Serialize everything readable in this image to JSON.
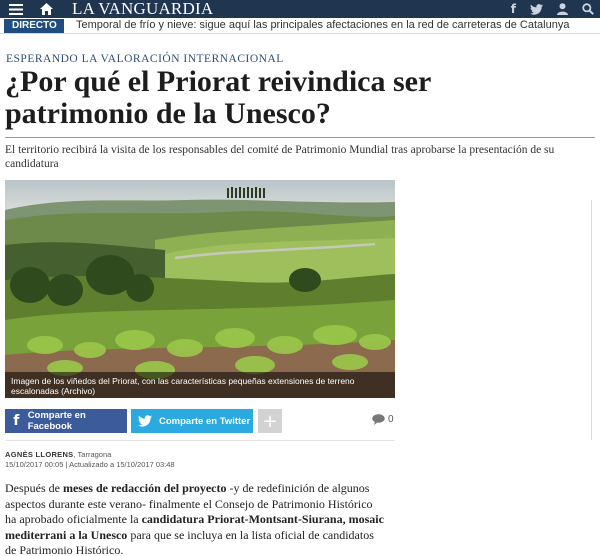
{
  "header": {
    "logo": "LA VANGUARDIA",
    "social": [
      "f",
      "t",
      "user",
      "search"
    ]
  },
  "breaking": {
    "tag": "DIRECTO",
    "headline": "Temporal de frío y nieve: sigue aquí las principales afectaciones en la red de carreteras de Catalunya"
  },
  "article": {
    "kicker": "ESPERANDO LA VALORACIÓN INTERNACIONAL",
    "title": "¿Por qué el Priorat reivindica ser patrimonio de la Unesco?",
    "subtitle": "El territorio recibirá la visita de los responsables del comité de Patrimonio Mundial tras aprobarse la presentación de su candidatura",
    "image_caption": "Imagen de los viñedos del Priorat, con las características pequeñas extensiones de terreno escalonadas (Archivo)",
    "share": {
      "facebook": "Comparte en Facebook",
      "twitter": "Comparte en Twitter",
      "more": "+",
      "comments_count": "0"
    },
    "byline": {
      "author": "AGNÈS LLORENS",
      "location": "Tarragona",
      "dates": "15/10/2017 00:05 | Actualizado a 15/10/2017 03:48"
    },
    "body": {
      "p1_a": "Después de ",
      "p1_b": "meses de redacción del proyecto",
      "p1_c": " -y de redefinición de algunos aspectos durante este verano- finalmente el Consejo de Patrimonio Histórico ha aprobado oficialmente la ",
      "p1_d": "candidatura Priorat-Montsant-Siurana, mosaic mediterrani a la Unesco",
      "p1_e": " para que se incluya en la lista oficial de candidatos de Patrimonio Histórico."
    }
  }
}
